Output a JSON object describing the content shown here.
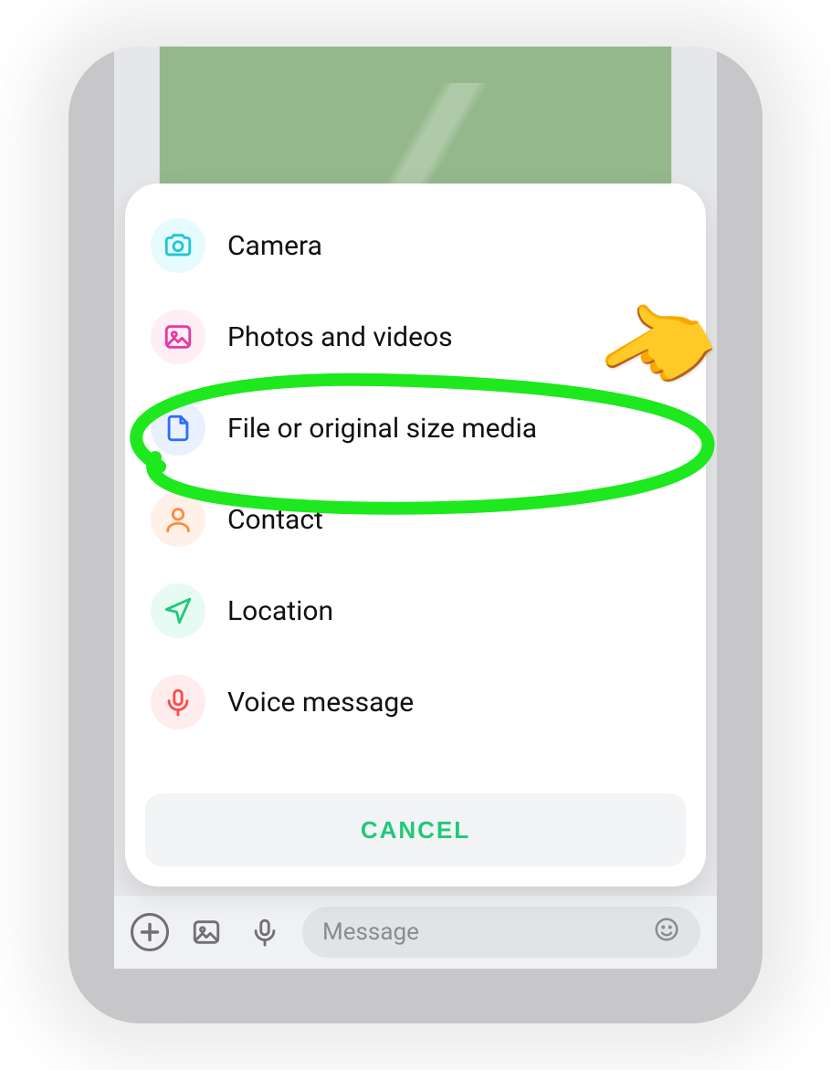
{
  "sheet": {
    "items": [
      {
        "label": "Camera"
      },
      {
        "label": "Photos and videos"
      },
      {
        "label": "File or original size media"
      },
      {
        "label": "Contact"
      },
      {
        "label": "Location"
      },
      {
        "label": "Voice message"
      }
    ],
    "cancel_label": "CANCEL"
  },
  "input_bar": {
    "placeholder": "Message"
  },
  "annotation": {
    "pointer_emoji": "👉",
    "highlight_color": "#1ee81e"
  }
}
